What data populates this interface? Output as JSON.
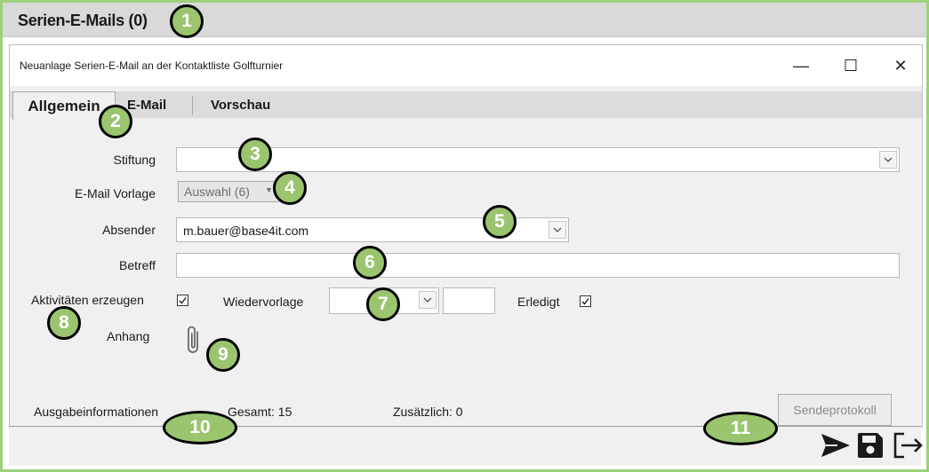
{
  "outer": {
    "title": "Serien-E-Mails (0)"
  },
  "dialog": {
    "title": "Neuanlage Serien-E-Mail an der Kontaktliste Golfturnier",
    "controls": {
      "minimize": "—",
      "maximize": "☐",
      "close": "✕"
    }
  },
  "tabs": [
    {
      "label": "Allgemein",
      "active": true
    },
    {
      "label": "E-Mail",
      "active": false
    },
    {
      "label": "Vorschau",
      "active": false
    }
  ],
  "form": {
    "stiftung": {
      "label": "Stiftung",
      "value": ""
    },
    "vorlage": {
      "label": "E-Mail Vorlage",
      "button": "Auswahl (6)"
    },
    "absender": {
      "label": "Absender",
      "value": "m.bauer@base4it.com"
    },
    "betreff": {
      "label": "Betreff",
      "value": ""
    },
    "aktivitaeten": {
      "label": "Aktivitäten erzeugen",
      "checked": true
    },
    "wiedervorlage": {
      "label": "Wiedervorlage",
      "date": "",
      "time": ""
    },
    "erledigt": {
      "label": "Erledigt",
      "checked": true
    },
    "anhang": {
      "label": "Anhang",
      "icon": "paperclip-icon"
    }
  },
  "output": {
    "label": "Ausgabeinformationen",
    "gesamt": "Gesamt: 15",
    "zusaetzlich": "Zusätzlich: 0",
    "sendeprotokoll": "Sendeprotokoll"
  },
  "actions": [
    {
      "name": "send-icon"
    },
    {
      "name": "save-icon"
    },
    {
      "name": "exit-icon"
    }
  ],
  "badges": [
    "1",
    "2",
    "3",
    "4",
    "5",
    "6",
    "7",
    "8",
    "9",
    "10",
    "11"
  ],
  "colors": {
    "badge": "#9bc46e",
    "frame": "#9ed07a"
  }
}
